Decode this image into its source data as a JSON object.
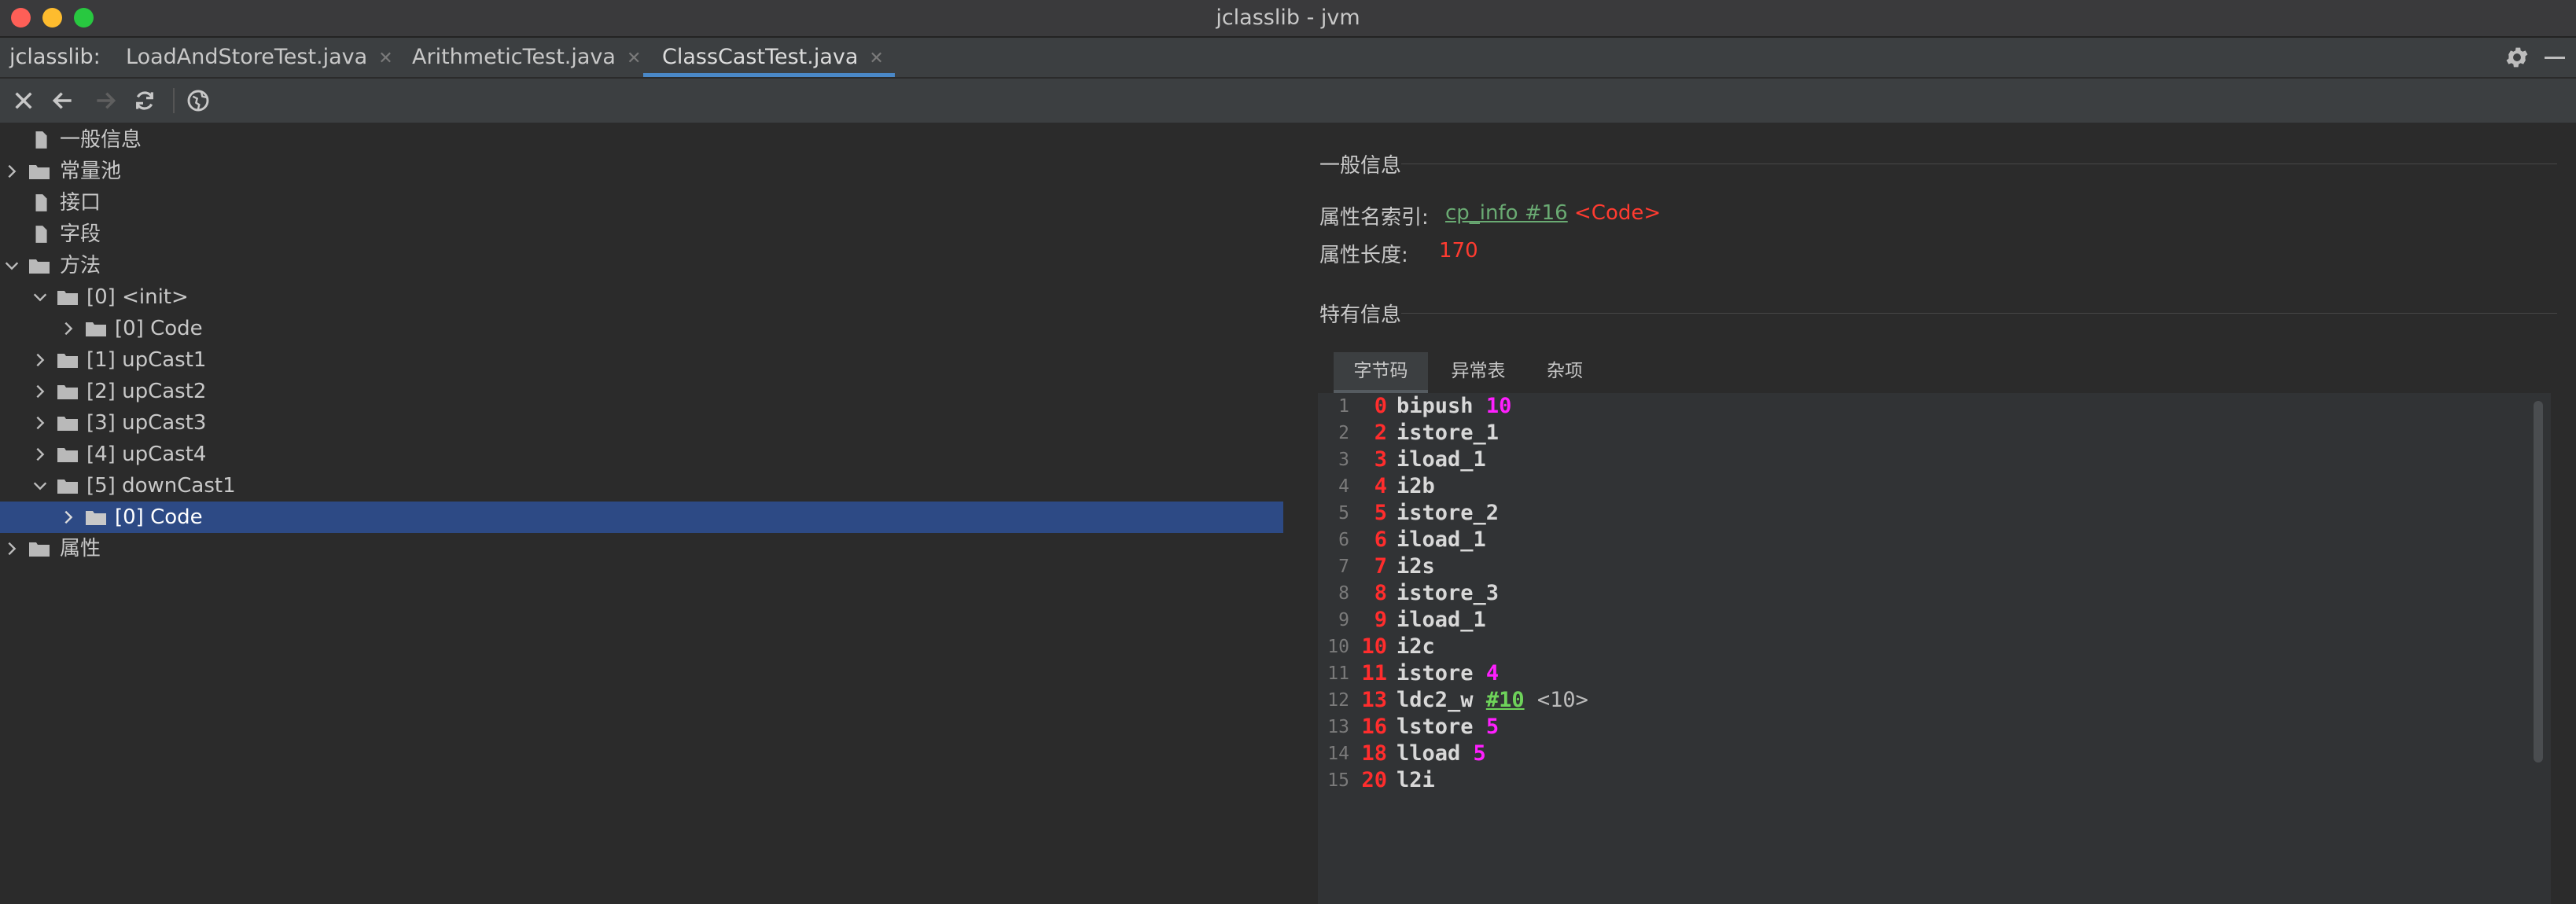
{
  "window": {
    "title": "jclasslib - jvm"
  },
  "tabs": {
    "prefix": "jclasslib:",
    "items": [
      {
        "label": "LoadAndStoreTest.java"
      },
      {
        "label": "ArithmeticTest.java"
      },
      {
        "label": "ClassCastTest.java",
        "active": true
      }
    ]
  },
  "tree": {
    "items": [
      {
        "label": "一般信息"
      },
      {
        "label": "常量池"
      },
      {
        "label": "接口"
      },
      {
        "label": "字段"
      },
      {
        "label": "方法"
      },
      {
        "label": "[0] <init>"
      },
      {
        "label": "[0] Code"
      },
      {
        "label": "[1] upCast1"
      },
      {
        "label": "[2] upCast2"
      },
      {
        "label": "[3] upCast3"
      },
      {
        "label": "[4] upCast4"
      },
      {
        "label": "[5] downCast1"
      },
      {
        "label": "[0] Code",
        "selected": true
      },
      {
        "label": "属性"
      }
    ]
  },
  "detail": {
    "general_title": "一般信息",
    "attr_name_label": "属性名索引:",
    "attr_name_link": "cp_info #16",
    "attr_name_value": "<Code>",
    "attr_len_label": "属性长度:",
    "attr_len_value": "170",
    "specific_title": "特有信息",
    "inner_tabs": [
      {
        "label": "字节码"
      },
      {
        "label": "异常表"
      },
      {
        "label": "杂项"
      }
    ]
  },
  "bytecode": [
    {
      "line": "1",
      "offset": "0",
      "op": "bipush",
      "arg": "10"
    },
    {
      "line": "2",
      "offset": "2",
      "op": "istore_1"
    },
    {
      "line": "3",
      "offset": "3",
      "op": "iload_1"
    },
    {
      "line": "4",
      "offset": "4",
      "op": "i2b"
    },
    {
      "line": "5",
      "offset": "5",
      "op": "istore_2"
    },
    {
      "line": "6",
      "offset": "6",
      "op": "iload_1"
    },
    {
      "line": "7",
      "offset": "7",
      "op": "i2s"
    },
    {
      "line": "8",
      "offset": "8",
      "op": "istore_3"
    },
    {
      "line": "9",
      "offset": "9",
      "op": "iload_1"
    },
    {
      "line": "10",
      "offset": "10",
      "op": "i2c"
    },
    {
      "line": "11",
      "offset": "11",
      "op": "istore",
      "arg": "4"
    },
    {
      "line": "12",
      "offset": "13",
      "op": "ldc2_w",
      "cparg": "#10",
      "comment": "<10>"
    },
    {
      "line": "13",
      "offset": "16",
      "op": "lstore",
      "arg": "5"
    },
    {
      "line": "14",
      "offset": "18",
      "op": "lload",
      "arg": "5"
    },
    {
      "line": "15",
      "offset": "20",
      "op": "l2i"
    }
  ],
  "colors": {
    "selection": "#2d4a85",
    "tab_underline": "#4a88c7",
    "offset": "#ff2d2d",
    "arg": "#ff1fff",
    "cp_link": "#6ed35a"
  }
}
